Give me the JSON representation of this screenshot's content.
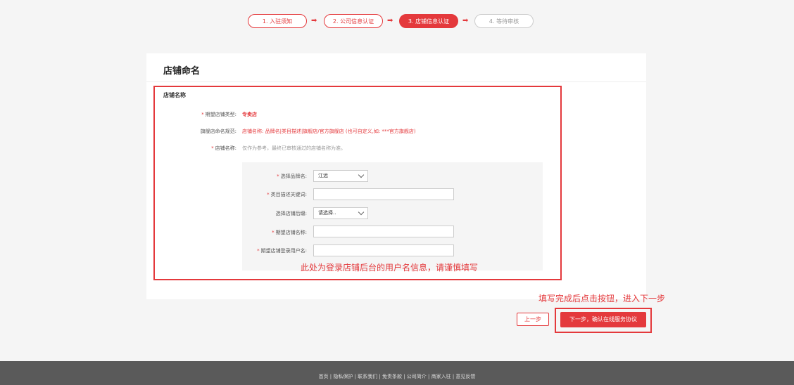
{
  "steps": {
    "s1": "1. 入驻须知",
    "s2": "2. 公司信息认证",
    "s3": "3. 店铺信息认证",
    "s4": "4. 等待审核",
    "arrow": "➡"
  },
  "card": {
    "title": "店铺命名"
  },
  "section": {
    "title": "店铺名称",
    "rows": [
      {
        "label": "期望店铺类型:",
        "required": "*",
        "value": "专卖店"
      },
      {
        "label": "旗舰店命名规范:",
        "required": "",
        "value": "店铺名称: 品牌名|类目描述|旗舰店/官方旗舰店 (也可自定义,如: ***官方旗舰店)"
      },
      {
        "label": "店铺名称:",
        "required": "*",
        "value": "仅作为参考，最终已审核通过的店铺名称为准。"
      }
    ]
  },
  "form": {
    "brand_label": "选择品牌名:",
    "brand_value": "江远",
    "keyword_label": "类目描述关键词:",
    "keyword_value": "",
    "suffix_label": "选择店铺后缀:",
    "suffix_value": "请选择..",
    "expected_name_label": "期望店铺名称:",
    "expected_name_value": "",
    "login_label": "期望店铺登录用户名:",
    "login_value": "",
    "req": "*"
  },
  "annotations": {
    "username_note": "此处为登录店铺后台的用户名信息，请谨慎填写",
    "button_note": "填写完成后点击按钮，进入下一步"
  },
  "buttons": {
    "prev": "上一步",
    "next": "下一步，确认在线服务协议"
  },
  "footer": {
    "links": "首页 | 隐私保护 | 联系我们 | 免责条款 | 公司简介 | 商家入驻 | 意见反馈"
  },
  "colors": {
    "accent": "#e4393c",
    "footer_bg": "#5a5a5a"
  }
}
